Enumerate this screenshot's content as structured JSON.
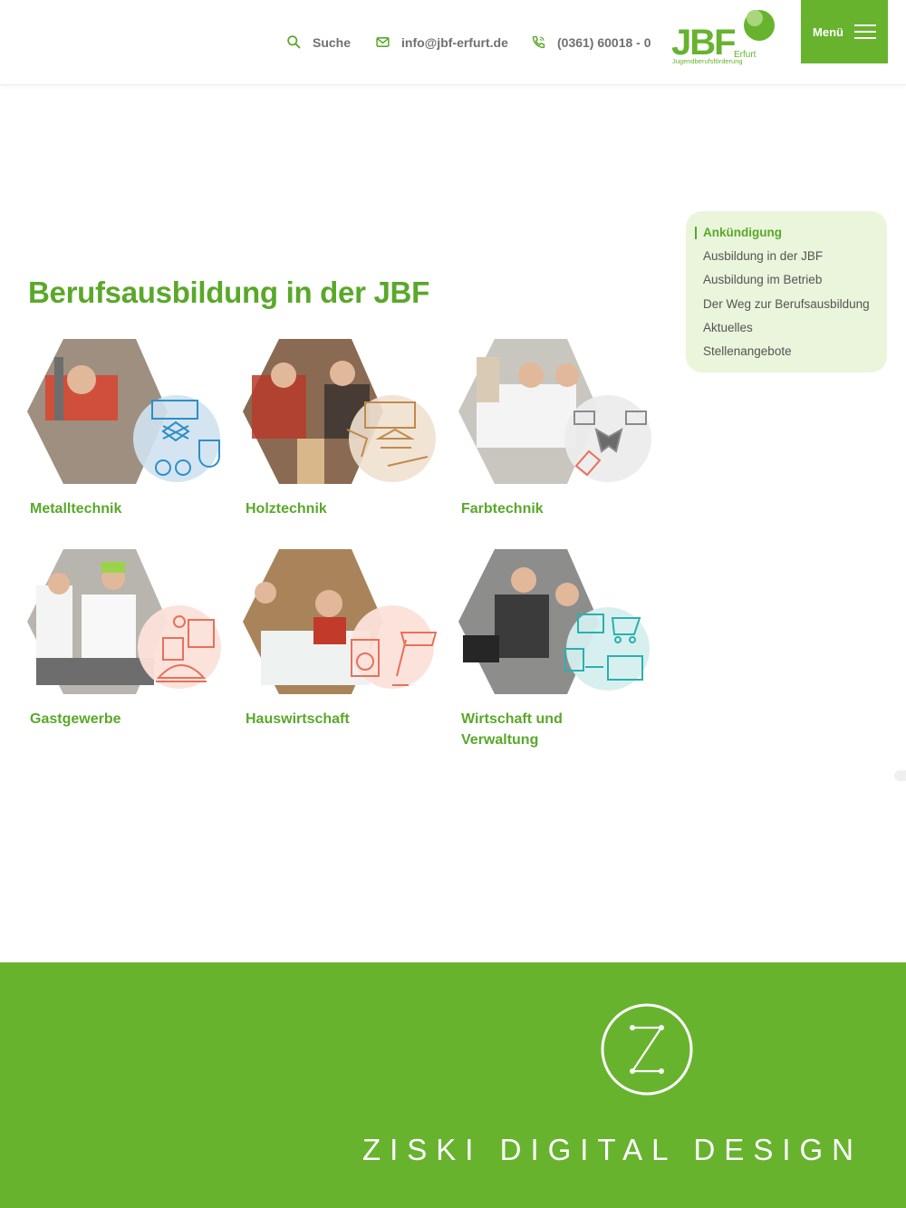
{
  "header": {
    "search_label": "Suche",
    "email": "info@jbf-erfurt.de",
    "phone": "(0361) 60018 - 0",
    "menu_label": "Menü",
    "logo": {
      "main": "JBF",
      "city": "Erfurt",
      "tagline": "Jugendberufsförderung"
    }
  },
  "subnav": {
    "items": [
      {
        "label": "Ankündigung",
        "active": true
      },
      {
        "label": "Ausbildung in der JBF"
      },
      {
        "label": "Ausbildung im Betrieb"
      },
      {
        "label": "Der Weg zur Berufsausbildung"
      },
      {
        "label": "Aktuelles"
      },
      {
        "label": "Stellenangebote"
      }
    ]
  },
  "main": {
    "title": "Berufsausbildung in der JBF",
    "cards": [
      {
        "label": "Metalltechnik",
        "icon": "metal-tools-icon",
        "accent": "#2f8ec8"
      },
      {
        "label": "Holztechnik",
        "icon": "wood-tools-icon",
        "accent": "#c08a4a"
      },
      {
        "label": "Farbtechnik",
        "icon": "paint-tools-icon",
        "accent": "#8a8a8a"
      },
      {
        "label": "Gastgewerbe",
        "icon": "kitchen-icon",
        "accent": "#e8705a"
      },
      {
        "label": "Hauswirtschaft",
        "icon": "household-icon",
        "accent": "#e8705a"
      },
      {
        "label": "Wirtschaft und Verwaltung",
        "label_line1": "Wirtschaft und",
        "label_line2": "Verwaltung",
        "icon": "office-icon",
        "accent": "#2ab0b0"
      }
    ]
  },
  "footer": {
    "brand": "ZISKI DIGITAL DESIGN",
    "logo_letter": "Z"
  },
  "colors": {
    "brand_green": "#67b32e",
    "text_green": "#5aa82a",
    "subnav_bg": "#eaf5dc"
  }
}
